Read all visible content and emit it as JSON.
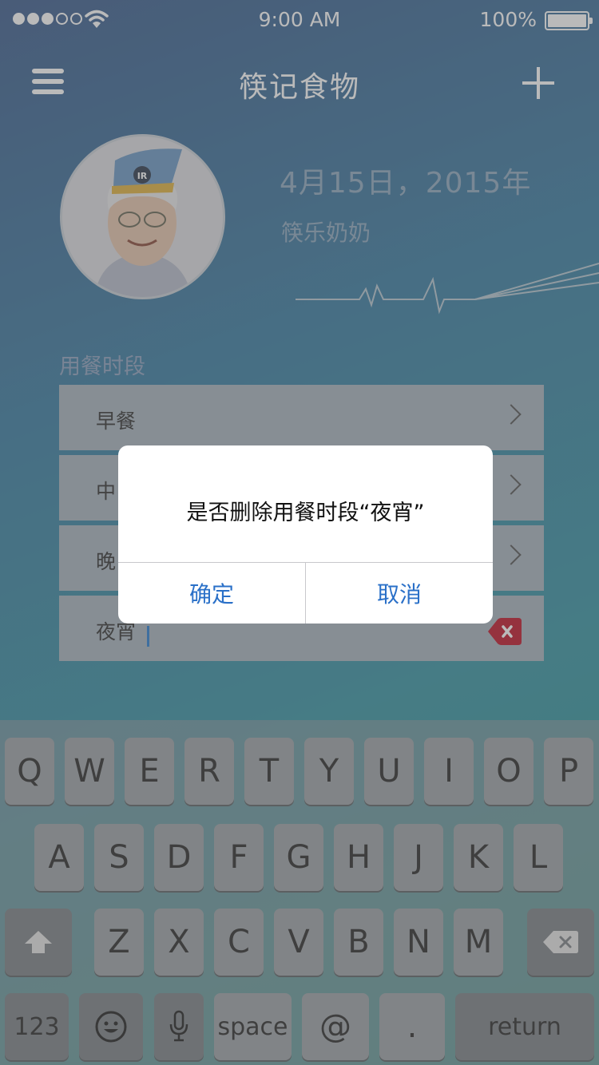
{
  "status_bar": {
    "time": "9:00 AM",
    "battery_percent": "100%",
    "signal_bars_filled": 3,
    "signal_bars_total": 5
  },
  "nav": {
    "title": "筷记食物"
  },
  "profile": {
    "date": "4月15日，2015年",
    "name": "筷乐奶奶",
    "avatar_badge": "IR"
  },
  "meals": {
    "section_label": "用餐时段",
    "rows": [
      {
        "label": "早餐"
      },
      {
        "label": "中"
      },
      {
        "label": "晚"
      },
      {
        "label": "夜宵"
      }
    ]
  },
  "dialog": {
    "message": "是否删除用餐时段“夜宵”",
    "confirm_label": "确定",
    "cancel_label": "取消"
  },
  "keyboard": {
    "row1": [
      "Q",
      "W",
      "E",
      "R",
      "T",
      "Y",
      "U",
      "I",
      "O",
      "P"
    ],
    "row2": [
      "A",
      "S",
      "D",
      "F",
      "G",
      "H",
      "J",
      "K",
      "L"
    ],
    "row3": [
      "Z",
      "X",
      "C",
      "V",
      "B",
      "N",
      "M"
    ],
    "numbers_label": "123",
    "space_label": "space",
    "at_label": "@",
    "period_label": ".",
    "return_label": "return"
  },
  "colors": {
    "accent": "#2a70c8",
    "delete_badge": "#c0152a"
  }
}
